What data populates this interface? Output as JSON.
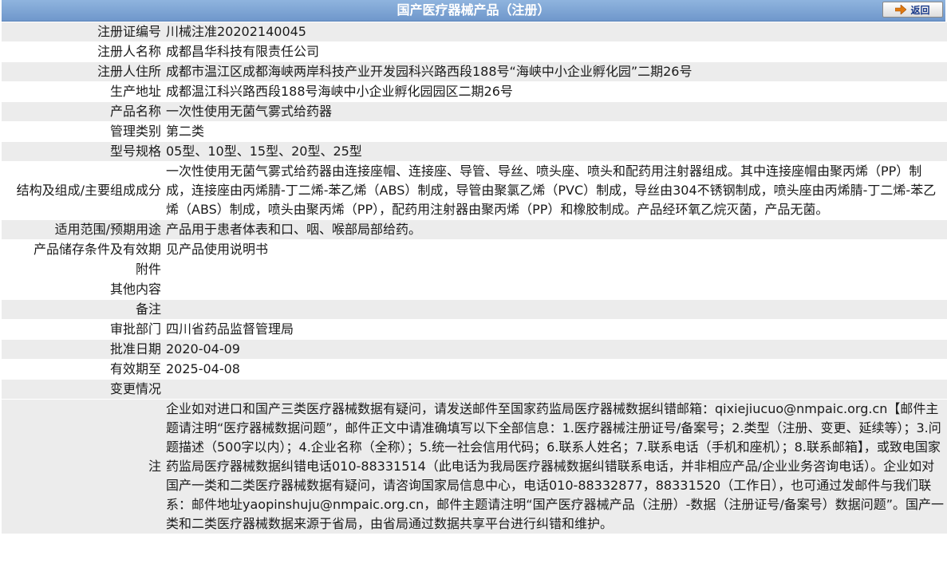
{
  "header": {
    "title": "国产医疗器械产品（注册）",
    "back_label": "返回",
    "back_icon": "arrow-right-icon",
    "accent": "#7aa2d4"
  },
  "rows": [
    {
      "label": "注册证编号",
      "value": "川械注准20202140045"
    },
    {
      "label": "注册人名称",
      "value": "成都昌华科技有限责任公司"
    },
    {
      "label": "注册人住所",
      "value": "成都市温江区成都海峡两岸科技产业开发园科兴路西段188号“海峡中小企业孵化园”二期26号"
    },
    {
      "label": "生产地址",
      "value": "成都温江科兴路西段188号海峡中小企业孵化园园区二期26号"
    },
    {
      "label": "产品名称",
      "value": "一次性使用无菌气雾式给药器"
    },
    {
      "label": "管理类别",
      "value": "第二类"
    },
    {
      "label": "型号规格",
      "value": "05型、10型、15型、20型、25型"
    },
    {
      "label": "结构及组成/主要组成成分",
      "value": "一次性使用无菌气雾式给药器由连接座帽、连接座、导管、导丝、喷头座、喷头和配药用注射器组成。其中连接座帽由聚丙烯（PP）制成，连接座由丙烯腈-丁二烯-苯乙烯（ABS）制成，导管由聚氯乙烯（PVC）制成，导丝由304不锈钢制成，喷头座由丙烯腈-丁二烯-苯乙烯（ABS）制成，喷头由聚丙烯（PP），配药用注射器由聚丙烯（PP）和橡胶制成。产品经环氧乙烷灭菌，产品无菌。"
    },
    {
      "label": "适用范围/预期用途",
      "value": "产品用于患者体表和口、咽、喉部局部给药。"
    },
    {
      "label": "产品储存条件及有效期",
      "value": "见产品使用说明书"
    },
    {
      "label": "附件",
      "value": ""
    },
    {
      "label": "其他内容",
      "value": ""
    },
    {
      "label": "备注",
      "value": ""
    },
    {
      "label": "审批部门",
      "value": "四川省药品监督管理局"
    },
    {
      "label": "批准日期",
      "value": "2020-04-09"
    },
    {
      "label": "有效期至",
      "value": "2025-04-08"
    },
    {
      "label": "变更情况",
      "value": ""
    }
  ],
  "note": {
    "label": "注",
    "value": "企业如对进口和国产三类医疗器械数据有疑问，请发送邮件至国家药监局医疗器械数据纠错邮箱：qixiejiucuo@nmpaic.org.cn【邮件主题请注明“医疗器械数据问题”，邮件正文中请准确填写以下全部信息：1.医疗器械注册证号/备案号；2.类型（注册、变更、延续等）；3.问题描述（500字以内）；4.企业名称（全称）；5.统一社会信用代码；6.联系人姓名；7.联系电话（手机和座机）；8.联系邮箱】，或致电国家药监局医疗器械数据纠错电话010-88331514（此电话为我局医疗器械数据纠错联系电话，并非相应产品/企业业务咨询电话）。企业如对国产一类和二类医疗器械数据有疑问，请咨询国家局信息中心，电话010-88332877，88331520（工作日），也可通过发邮件与我们联系：邮件地址yaopinshuju@nmpaic.org.cn，邮件主题请注明“国产医疗器械产品（注册）-数据（注册证号/备案号）数据问题”。国产一类和二类医疗器械数据来源于省局，由省局通过数据共享平台进行纠错和维护。"
  }
}
